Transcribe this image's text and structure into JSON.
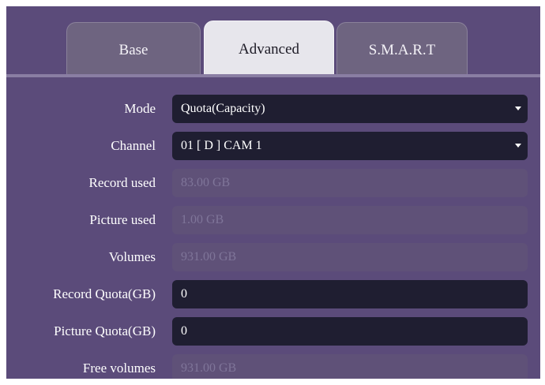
{
  "tabs": [
    {
      "label": "Base",
      "active": false
    },
    {
      "label": "Advanced",
      "active": true
    },
    {
      "label": "S.M.A.R.T",
      "active": false
    }
  ],
  "form": {
    "mode": {
      "label": "Mode",
      "value": "Quota(Capacity)",
      "icon": "chevron-down-icon"
    },
    "channel": {
      "label": "Channel",
      "value": "01 [ D ] CAM 1",
      "icon": "chevron-down-icon"
    },
    "record_used": {
      "label": "Record used",
      "value": "83.00 GB"
    },
    "picture_used": {
      "label": "Picture used",
      "value": "1.00 GB"
    },
    "volumes": {
      "label": "Volumes",
      "value": "931.00 GB"
    },
    "record_quota": {
      "label": "Record Quota(GB)",
      "value": "0"
    },
    "picture_quota": {
      "label": "Picture Quota(GB)",
      "value": "0"
    },
    "free_volumes": {
      "label": "Free volumes",
      "value": "931.00 GB"
    }
  },
  "colors": {
    "panel_background": "#5b4b7a",
    "field_dark": "#1f1e31",
    "field_disabled": "#5f5178",
    "active_tab": "#e7e6ec",
    "inactive_tab": "#6e6480"
  }
}
